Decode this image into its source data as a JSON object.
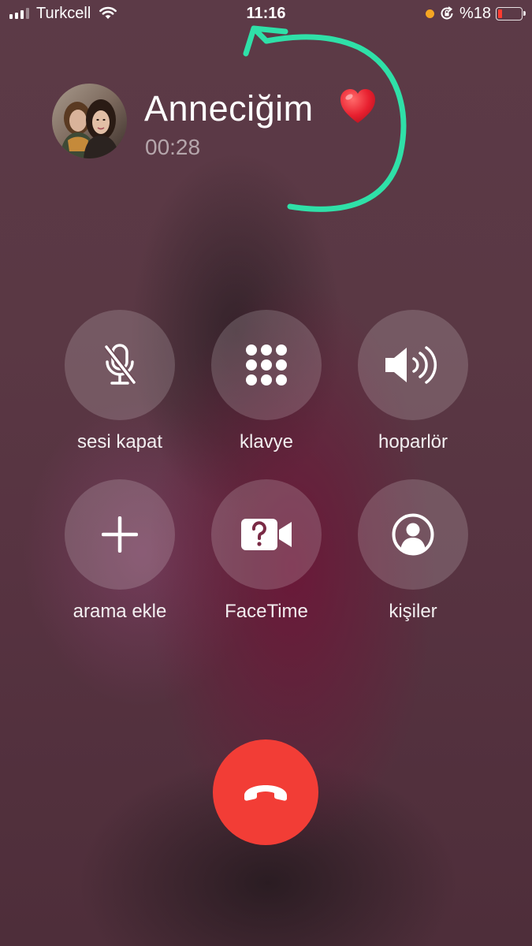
{
  "status_bar": {
    "carrier": "Turkcell",
    "time": "11:16",
    "battery_text": "%18",
    "battery_level": 0.18,
    "icons": [
      "signal-icon",
      "wifi-icon",
      "orange-dot-indicator",
      "rotation-lock-icon",
      "battery-icon"
    ]
  },
  "caller": {
    "name": "Anneciğim",
    "emoji": "heart-icon",
    "duration": "00:28"
  },
  "controls": [
    {
      "label": "sesi kapat",
      "icon": "mic-off-icon"
    },
    {
      "label": "klavye",
      "icon": "keypad-icon"
    },
    {
      "label": "hoparlör",
      "icon": "speaker-icon"
    },
    {
      "label": "arama ekle",
      "icon": "plus-icon"
    },
    {
      "label": "FaceTime",
      "icon": "facetime-icon"
    },
    {
      "label": "kişiler",
      "icon": "contact-icon"
    }
  ],
  "end_call": {
    "icon": "end-call-icon"
  },
  "colors": {
    "end_call": "#f23d36",
    "annotation": "#2fe0a8",
    "heart": "#e8202f"
  }
}
